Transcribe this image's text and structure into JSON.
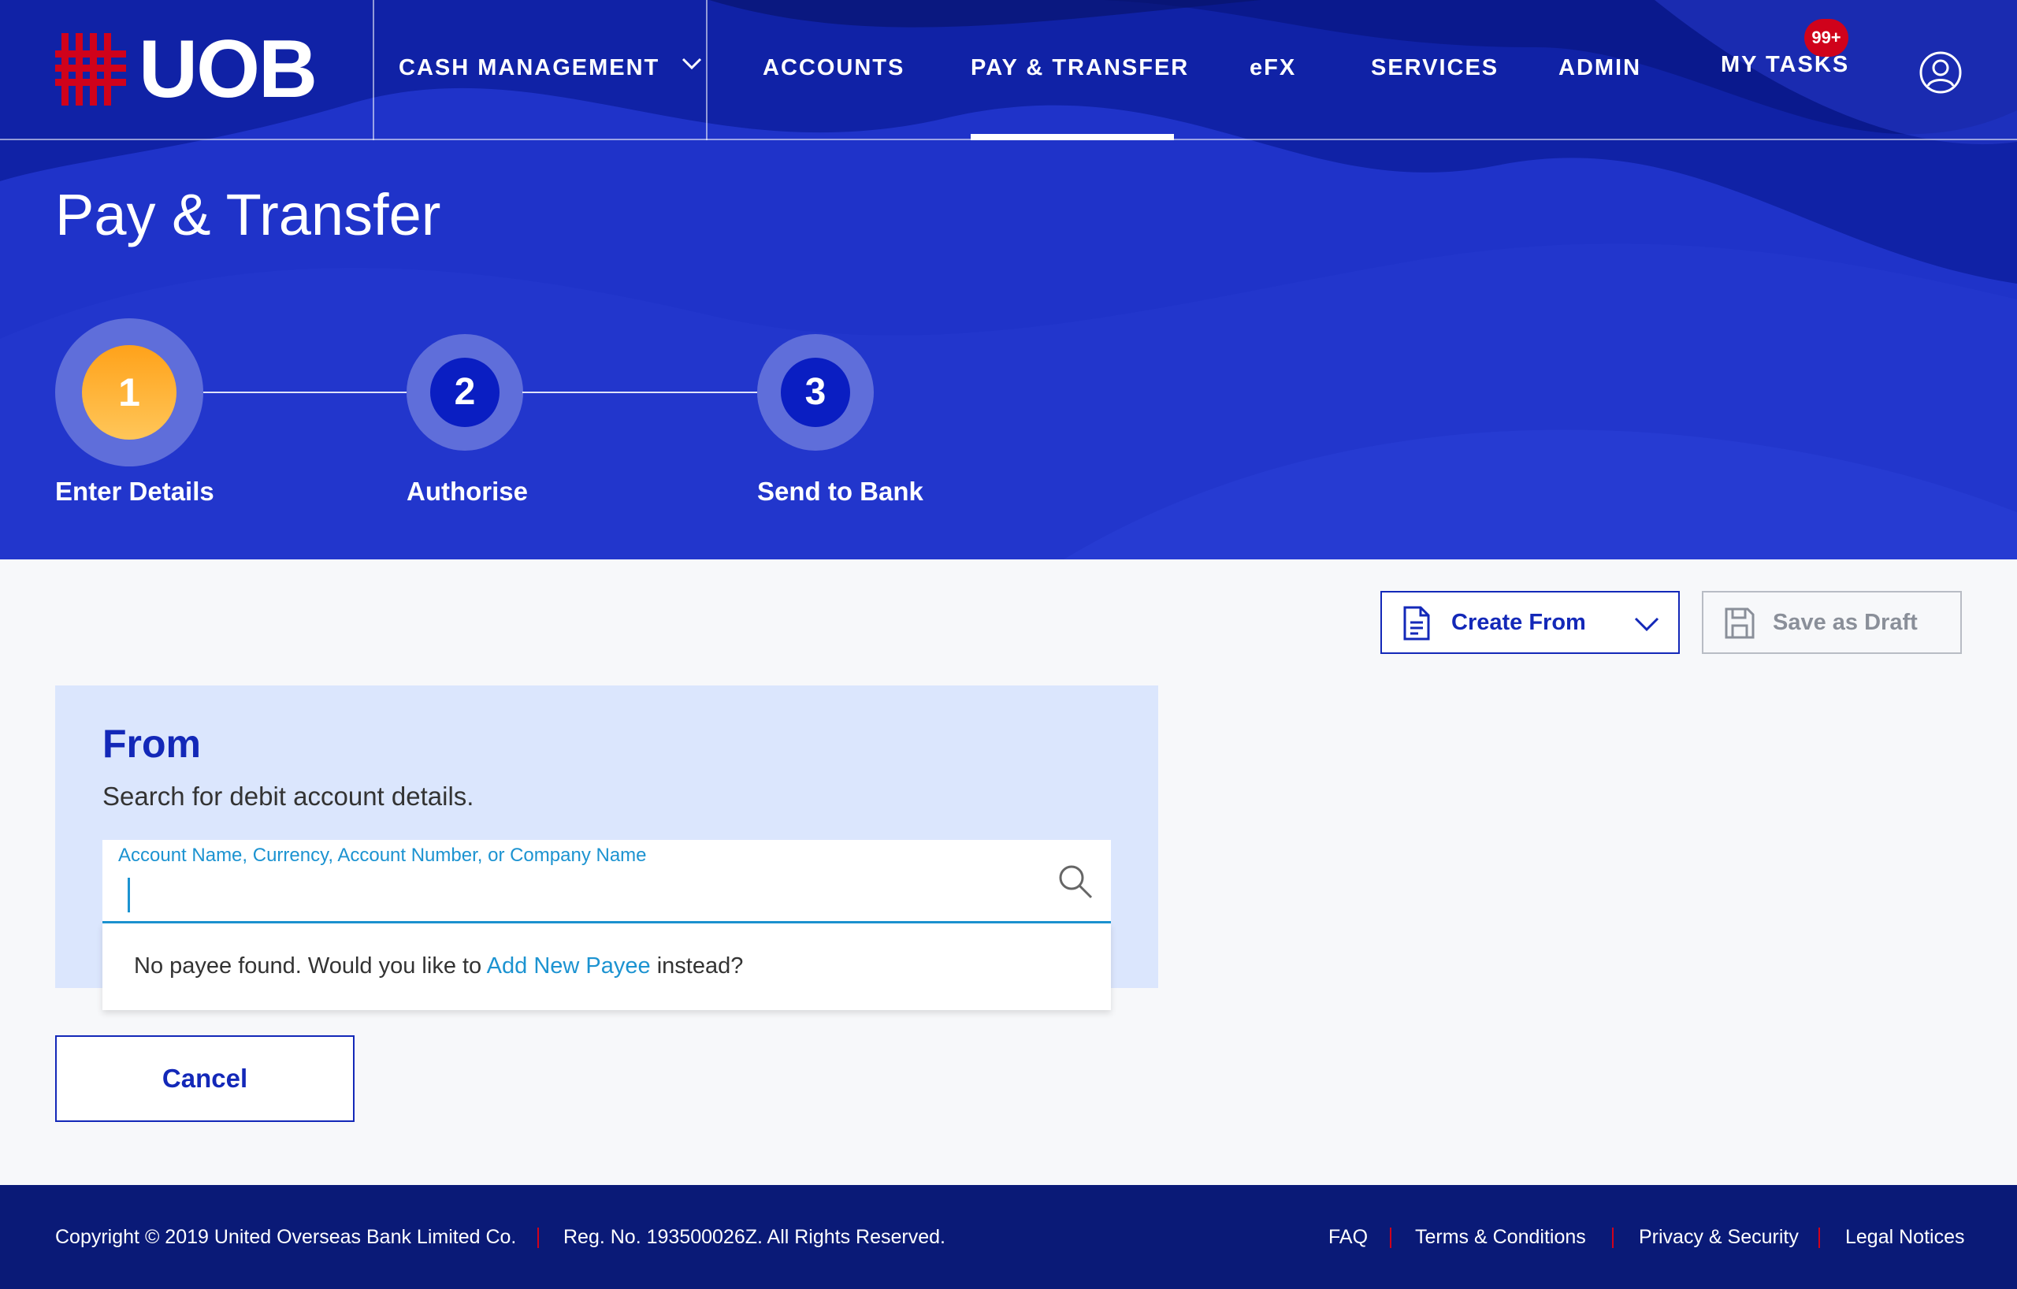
{
  "brand": {
    "name": "UOB",
    "color": "#d0021b"
  },
  "nav": {
    "cash_management": "CASH MANAGEMENT",
    "accounts": "ACCOUNTS",
    "pay_transfer": "PAY & TRANSFER",
    "efx": "eFX",
    "services": "SERVICES",
    "admin": "ADMIN",
    "my_tasks": "MY TASKS",
    "tasks_badge": "99+",
    "active": "PAY & TRANSFER"
  },
  "page": {
    "title": "Pay & Transfer"
  },
  "stepper": {
    "current_step": 1,
    "steps": [
      {
        "number": "1",
        "label": "Enter Details"
      },
      {
        "number": "2",
        "label": "Authorise"
      },
      {
        "number": "3",
        "label": "Send to Bank"
      }
    ]
  },
  "toolbar": {
    "create_from": "Create From",
    "save_draft": "Save as Draft"
  },
  "from_section": {
    "title": "From",
    "subtitle": "Search for debit account details.",
    "search_label": "Account Name, Currency, Account Number, or Company Name",
    "search_value": "",
    "no_result_prefix": "No payee found. Would you like to",
    "no_result_link": "Add New Payee",
    "no_result_suffix": "instead?"
  },
  "actions": {
    "cancel": "Cancel"
  },
  "footer": {
    "copyright": "Copyright © 2019 United Overseas Bank Limited Co.",
    "reg": "Reg. No. 193500026Z. All Rights Reserved.",
    "links": [
      "FAQ",
      "Terms & Conditions",
      "Privacy & Security",
      "Legal Notices"
    ]
  },
  "colors": {
    "primary": "#1328b8",
    "hero_bg": "#1f33c9",
    "step_active": "#ffa726",
    "accent_link": "#1c93d1",
    "footer_bg": "#0a1a77"
  }
}
